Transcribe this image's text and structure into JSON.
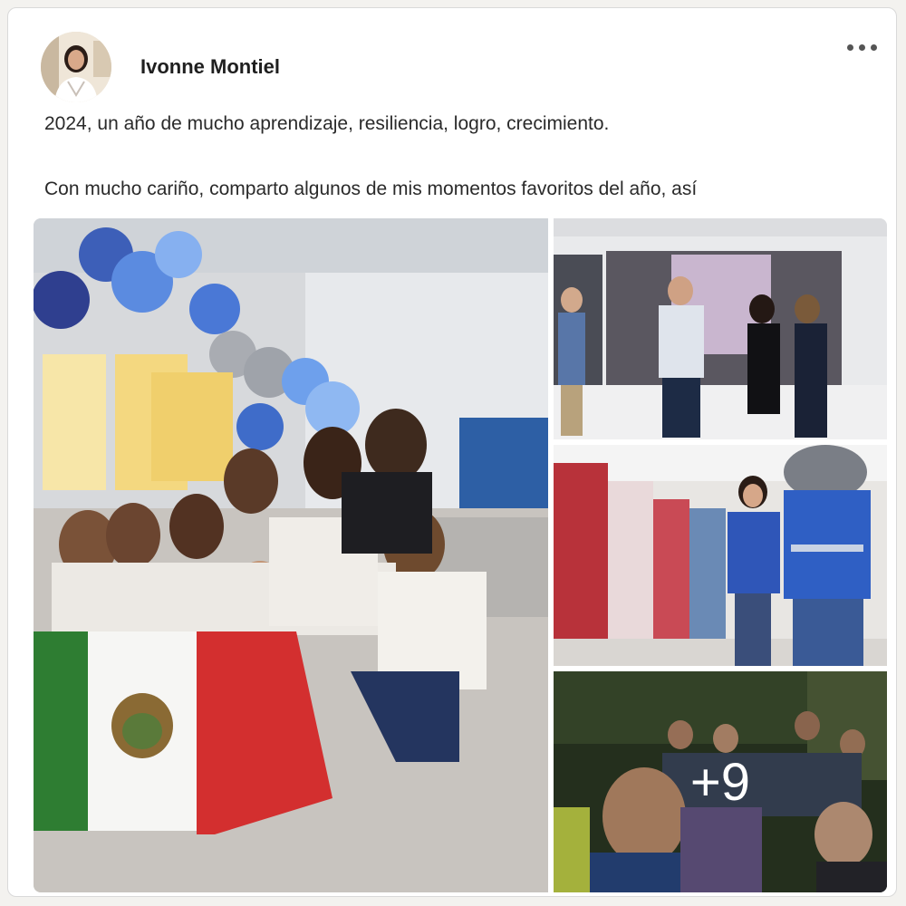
{
  "post": {
    "author": "Ivonne Montiel",
    "text_line1": "2024, un año de mucho aprendizaje, resiliencia, logro, crecimiento.",
    "text_line2": "Con mucho cariño, comparto algunos de mis momentos favoritos del año, así",
    "more_photos_label": "+9"
  },
  "icons": {
    "more": "more-horizontal-icon"
  },
  "colors": {
    "accent_blue": "#1e4fa8",
    "flag_green": "#2e7d32",
    "flag_red": "#d32f2f"
  }
}
